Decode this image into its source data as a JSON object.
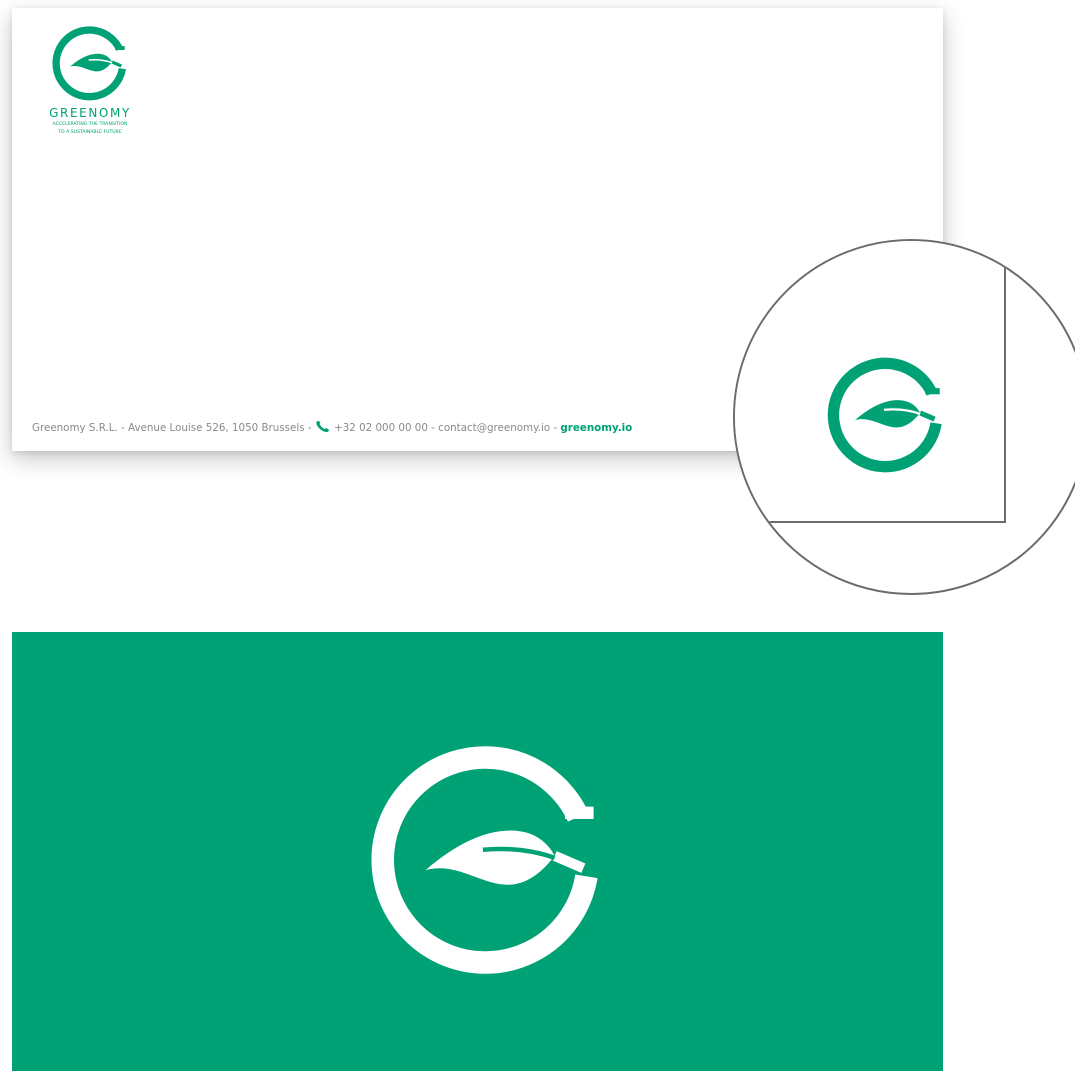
{
  "brand": {
    "name": "GREENOMY",
    "tagline_line1": "ACCELERATING THE TRANSITION",
    "tagline_line2": "TO A SUSTAINABLE FUTURE",
    "color_primary": "#00a175",
    "color_muted": "#8a8a8a"
  },
  "footer": {
    "company_address": "Greenomy S.R.L. - Avenue Louise 526, 1050 Brussels - ",
    "phone_icon": "phone-icon",
    "phone": "+32 02 000 00 00",
    "separator": " - ",
    "email": "contact@greenomy.io",
    "separator2": " - ",
    "website": "greenomy.io"
  },
  "icons": {
    "logo": "greenomy-leaf-g-logo",
    "zoom_logo": "greenomy-leaf-g-logo",
    "back_logo": "greenomy-leaf-g-logo-white"
  }
}
